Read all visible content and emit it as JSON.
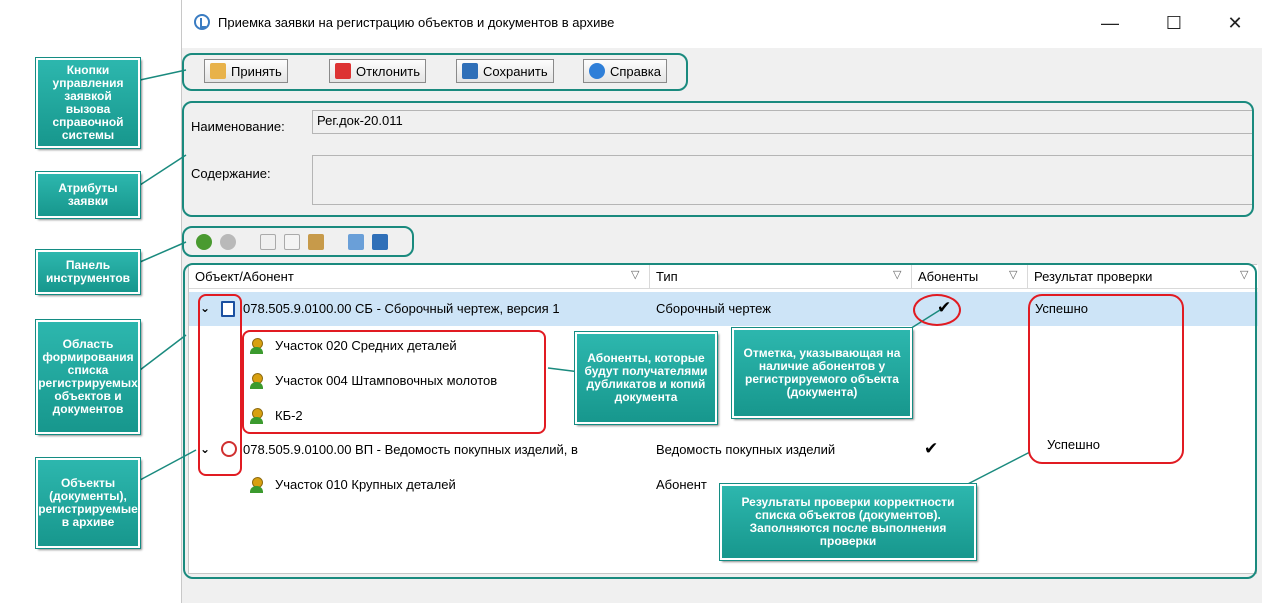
{
  "window": {
    "title": "Приемка заявки на регистрацию объектов и документов в архиве",
    "minimize": "—",
    "maximize": "☐",
    "close": "✕"
  },
  "toolbar": {
    "accept": "Принять",
    "reject": "Отклонить",
    "save": "Сохранить",
    "help": "Справка"
  },
  "fields": {
    "name_label": "Наименование:",
    "name_value": "Рег.док-20.011",
    "content_label": "Содержание:",
    "content_value": ""
  },
  "inner_toolbar_icons": [
    "add-subscriber-icon",
    "remove-icon",
    "cut-icon",
    "copy-icon",
    "paste-icon",
    "check-list-icon",
    "save-list-icon"
  ],
  "grid": {
    "headers": [
      "Объект/Абонент",
      "Тип",
      "Абоненты",
      "Результат проверки"
    ],
    "rows": [
      {
        "object": "078.505.9.0100.00 СБ - Сборочный чертеж, версия 1",
        "type": "Сборочный чертеж",
        "subscribers": "✔",
        "result": "Успешно"
      },
      {
        "object": "Участок 020 Средних деталей"
      },
      {
        "object": "Участок 004 Штамповочных молотов"
      },
      {
        "object": "КБ-2"
      },
      {
        "object": "078.505.9.0100.00 ВП - Ведомость покупных изделий, в",
        "type": "Ведомость покупных изделий",
        "subscribers": "✔",
        "result": "Успешно"
      },
      {
        "object": "Участок 010 Крупных деталей",
        "type": "Абонент"
      }
    ]
  },
  "callouts": {
    "buttons": "Кнопки управления заявкой вызова справочной системы",
    "attributes": "Атрибуты заявки",
    "panel": "Панель инструментов",
    "area": "Область формирования списка регистрируемых объектов и документов",
    "objects": "Объекты (документы), регистрируемые в архиве",
    "subscribers": "Абоненты, которые будут получателями дубликатов и копий документа",
    "mark": "Отметка, указывающая на наличие абонентов у регистрируемого объекта (документа)",
    "results": "Результаты проверки корректности списка объектов (документов). Заполняются после выполнения проверки"
  },
  "colors": {
    "accent_teal": "#1a8a7e",
    "highlight_red": "#e11b22",
    "selection": "#cde4f7"
  }
}
